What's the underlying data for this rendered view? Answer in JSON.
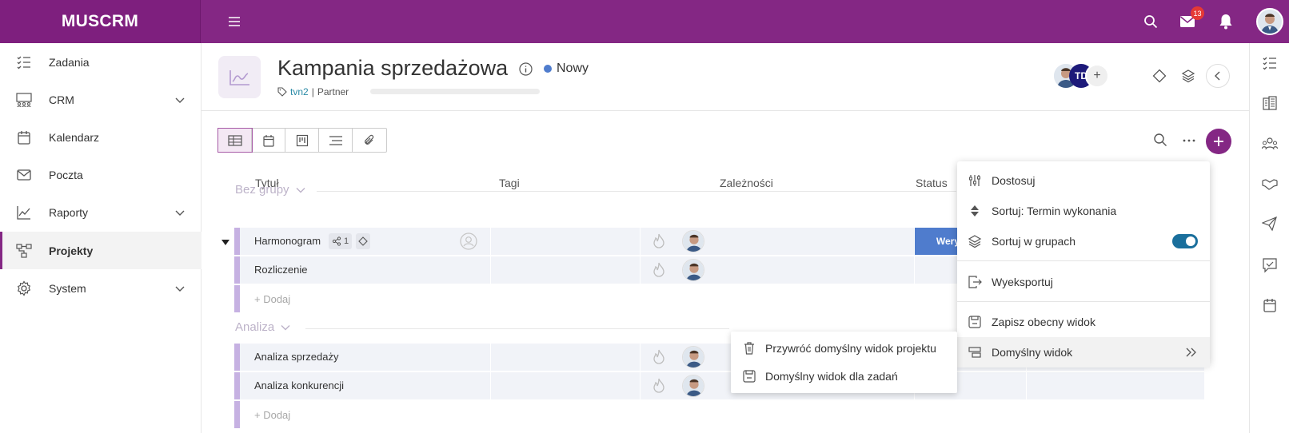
{
  "app": {
    "brand": "MUSCRM",
    "mail_count": "13"
  },
  "sidebar": {
    "items": [
      {
        "label": "Zadania",
        "icon": "tasks-icon",
        "expandable": false
      },
      {
        "label": "CRM",
        "icon": "crm-icon",
        "expandable": true
      },
      {
        "label": "Kalendarz",
        "icon": "calendar-icon",
        "expandable": false
      },
      {
        "label": "Poczta",
        "icon": "mail-icon",
        "expandable": false
      },
      {
        "label": "Raporty",
        "icon": "reports-icon",
        "expandable": true
      },
      {
        "label": "Projekty",
        "icon": "projects-icon",
        "expandable": false,
        "active": true
      },
      {
        "label": "System",
        "icon": "gear-icon",
        "expandable": true
      }
    ]
  },
  "project": {
    "title": "Kampania sprzedażowa",
    "status": "Nowy",
    "status_color": "#4f7ccd",
    "tag": "tvn2",
    "category": "Partner",
    "member_initials": "TD",
    "add_member": "+"
  },
  "table": {
    "columns": {
      "title": "Tytuł",
      "tags": "Tagi",
      "dependencies": "Zależności",
      "status": "Status"
    },
    "groups": [
      {
        "name": "Bez grupy",
        "rows": [
          {
            "title": "Harmonogram",
            "share_count": "1",
            "status": "Wery"
          },
          {
            "title": "Rozliczenie"
          }
        ],
        "add_label": "+ Dodaj"
      },
      {
        "name": "Analiza",
        "rows": [
          {
            "title": "Analiza sprzedaży"
          },
          {
            "title": "Analiza konkurencji"
          }
        ],
        "add_label": "+ Dodaj"
      }
    ]
  },
  "menu": {
    "items": [
      {
        "label": "Dostosuj",
        "icon": "sliders-icon"
      },
      {
        "label": "Sortuj: Termin wykonania",
        "icon": "sort-icon"
      },
      {
        "label": "Sortuj w grupach",
        "icon": "layers-icon",
        "toggle": true
      },
      {
        "label": "Wyeksportuj",
        "icon": "export-icon"
      },
      {
        "label": "Zapisz obecny widok",
        "icon": "save-view-icon"
      },
      {
        "label": "Domyślny widok",
        "icon": "default-view-icon",
        "submenu": true
      }
    ]
  },
  "submenu": {
    "items": [
      {
        "label": "Przywróć domyślny widok projektu",
        "icon": "trash-icon"
      },
      {
        "label": "Domyślny widok dla zadań",
        "icon": "save-view-icon"
      }
    ]
  },
  "colors": {
    "brand": "#842784",
    "accent": "#842784",
    "row_bar": "#c6b1e2",
    "status_bar": "#4f7ccd"
  }
}
